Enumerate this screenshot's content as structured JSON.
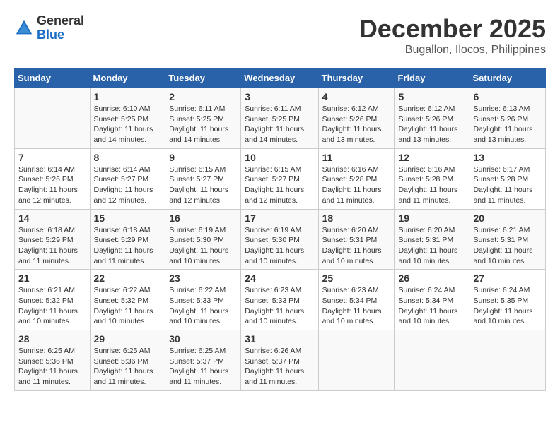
{
  "logo": {
    "general": "General",
    "blue": "Blue"
  },
  "title": {
    "month": "December 2025",
    "location": "Bugallon, Ilocos, Philippines"
  },
  "days_of_week": [
    "Sunday",
    "Monday",
    "Tuesday",
    "Wednesday",
    "Thursday",
    "Friday",
    "Saturday"
  ],
  "weeks": [
    [
      {
        "day": "",
        "info": ""
      },
      {
        "day": "1",
        "info": "Sunrise: 6:10 AM\nSunset: 5:25 PM\nDaylight: 11 hours\nand 14 minutes."
      },
      {
        "day": "2",
        "info": "Sunrise: 6:11 AM\nSunset: 5:25 PM\nDaylight: 11 hours\nand 14 minutes."
      },
      {
        "day": "3",
        "info": "Sunrise: 6:11 AM\nSunset: 5:25 PM\nDaylight: 11 hours\nand 14 minutes."
      },
      {
        "day": "4",
        "info": "Sunrise: 6:12 AM\nSunset: 5:26 PM\nDaylight: 11 hours\nand 13 minutes."
      },
      {
        "day": "5",
        "info": "Sunrise: 6:12 AM\nSunset: 5:26 PM\nDaylight: 11 hours\nand 13 minutes."
      },
      {
        "day": "6",
        "info": "Sunrise: 6:13 AM\nSunset: 5:26 PM\nDaylight: 11 hours\nand 13 minutes."
      }
    ],
    [
      {
        "day": "7",
        "info": "Sunrise: 6:14 AM\nSunset: 5:26 PM\nDaylight: 11 hours\nand 12 minutes."
      },
      {
        "day": "8",
        "info": "Sunrise: 6:14 AM\nSunset: 5:27 PM\nDaylight: 11 hours\nand 12 minutes."
      },
      {
        "day": "9",
        "info": "Sunrise: 6:15 AM\nSunset: 5:27 PM\nDaylight: 11 hours\nand 12 minutes."
      },
      {
        "day": "10",
        "info": "Sunrise: 6:15 AM\nSunset: 5:27 PM\nDaylight: 11 hours\nand 12 minutes."
      },
      {
        "day": "11",
        "info": "Sunrise: 6:16 AM\nSunset: 5:28 PM\nDaylight: 11 hours\nand 11 minutes."
      },
      {
        "day": "12",
        "info": "Sunrise: 6:16 AM\nSunset: 5:28 PM\nDaylight: 11 hours\nand 11 minutes."
      },
      {
        "day": "13",
        "info": "Sunrise: 6:17 AM\nSunset: 5:28 PM\nDaylight: 11 hours\nand 11 minutes."
      }
    ],
    [
      {
        "day": "14",
        "info": "Sunrise: 6:18 AM\nSunset: 5:29 PM\nDaylight: 11 hours\nand 11 minutes."
      },
      {
        "day": "15",
        "info": "Sunrise: 6:18 AM\nSunset: 5:29 PM\nDaylight: 11 hours\nand 11 minutes."
      },
      {
        "day": "16",
        "info": "Sunrise: 6:19 AM\nSunset: 5:30 PM\nDaylight: 11 hours\nand 10 minutes."
      },
      {
        "day": "17",
        "info": "Sunrise: 6:19 AM\nSunset: 5:30 PM\nDaylight: 11 hours\nand 10 minutes."
      },
      {
        "day": "18",
        "info": "Sunrise: 6:20 AM\nSunset: 5:31 PM\nDaylight: 11 hours\nand 10 minutes."
      },
      {
        "day": "19",
        "info": "Sunrise: 6:20 AM\nSunset: 5:31 PM\nDaylight: 11 hours\nand 10 minutes."
      },
      {
        "day": "20",
        "info": "Sunrise: 6:21 AM\nSunset: 5:31 PM\nDaylight: 11 hours\nand 10 minutes."
      }
    ],
    [
      {
        "day": "21",
        "info": "Sunrise: 6:21 AM\nSunset: 5:32 PM\nDaylight: 11 hours\nand 10 minutes."
      },
      {
        "day": "22",
        "info": "Sunrise: 6:22 AM\nSunset: 5:32 PM\nDaylight: 11 hours\nand 10 minutes."
      },
      {
        "day": "23",
        "info": "Sunrise: 6:22 AM\nSunset: 5:33 PM\nDaylight: 11 hours\nand 10 minutes."
      },
      {
        "day": "24",
        "info": "Sunrise: 6:23 AM\nSunset: 5:33 PM\nDaylight: 11 hours\nand 10 minutes."
      },
      {
        "day": "25",
        "info": "Sunrise: 6:23 AM\nSunset: 5:34 PM\nDaylight: 11 hours\nand 10 minutes."
      },
      {
        "day": "26",
        "info": "Sunrise: 6:24 AM\nSunset: 5:34 PM\nDaylight: 11 hours\nand 10 minutes."
      },
      {
        "day": "27",
        "info": "Sunrise: 6:24 AM\nSunset: 5:35 PM\nDaylight: 11 hours\nand 10 minutes."
      }
    ],
    [
      {
        "day": "28",
        "info": "Sunrise: 6:25 AM\nSunset: 5:36 PM\nDaylight: 11 hours\nand 11 minutes."
      },
      {
        "day": "29",
        "info": "Sunrise: 6:25 AM\nSunset: 5:36 PM\nDaylight: 11 hours\nand 11 minutes."
      },
      {
        "day": "30",
        "info": "Sunrise: 6:25 AM\nSunset: 5:37 PM\nDaylight: 11 hours\nand 11 minutes."
      },
      {
        "day": "31",
        "info": "Sunrise: 6:26 AM\nSunset: 5:37 PM\nDaylight: 11 hours\nand 11 minutes."
      },
      {
        "day": "",
        "info": ""
      },
      {
        "day": "",
        "info": ""
      },
      {
        "day": "",
        "info": ""
      }
    ]
  ]
}
